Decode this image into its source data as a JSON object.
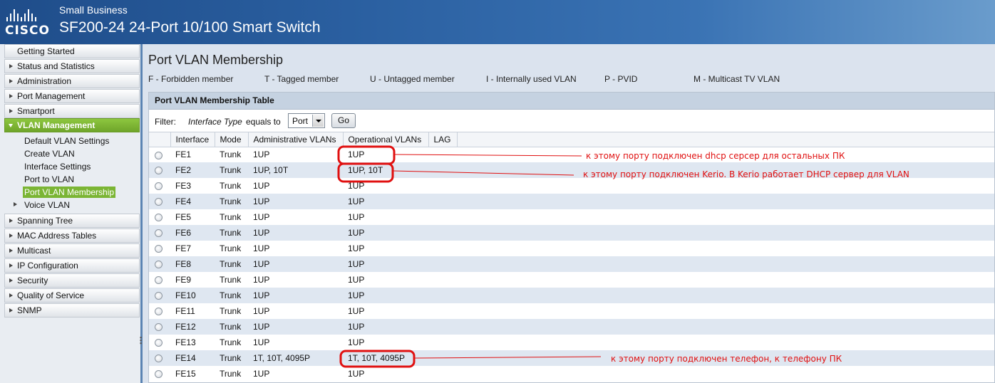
{
  "header": {
    "logo_text": "CISCO",
    "brand": "Small Business",
    "product": "SF200-24 24-Port 10/100 Smart Switch"
  },
  "sidebar": {
    "items": [
      {
        "label": "Getting Started"
      },
      {
        "label": "Status and Statistics"
      },
      {
        "label": "Administration"
      },
      {
        "label": "Port Management"
      },
      {
        "label": "Smartport"
      },
      {
        "label": "VLAN Management"
      },
      {
        "label": "Spanning Tree"
      },
      {
        "label": "MAC Address Tables"
      },
      {
        "label": "Multicast"
      },
      {
        "label": "IP Configuration"
      },
      {
        "label": "Security"
      },
      {
        "label": "Quality of Service"
      },
      {
        "label": "SNMP"
      }
    ],
    "vlan_sub_items": [
      {
        "label": "Default VLAN Settings"
      },
      {
        "label": "Create VLAN"
      },
      {
        "label": "Interface Settings"
      },
      {
        "label": "Port to VLAN"
      },
      {
        "label": "Port VLAN Membership"
      },
      {
        "label": "Voice VLAN"
      }
    ],
    "active_item": "VLAN Management",
    "selected_sub_item": "Port VLAN Membership"
  },
  "main": {
    "title": "Port VLAN Membership",
    "legend": [
      "F - Forbidden member",
      "T - Tagged member",
      "U - Untagged member",
      "I - Internally used VLAN",
      "P - PVID",
      "M - Multicast TV VLAN"
    ],
    "table_title": "Port VLAN Membership Table",
    "filter": {
      "label": "Filter:",
      "field": "Interface Type",
      "operator": "equals to",
      "selected": "Port",
      "go_label": "Go"
    },
    "columns": [
      "Interface",
      "Mode",
      "Administrative VLANs",
      "Operational VLANs",
      "LAG"
    ],
    "rows": [
      {
        "interface": "FE1",
        "mode": "Trunk",
        "admin": "1UP",
        "oper": "1UP",
        "lag": ""
      },
      {
        "interface": "FE2",
        "mode": "Trunk",
        "admin": "1UP, 10T",
        "oper": "1UP, 10T",
        "lag": ""
      },
      {
        "interface": "FE3",
        "mode": "Trunk",
        "admin": "1UP",
        "oper": "1UP",
        "lag": ""
      },
      {
        "interface": "FE4",
        "mode": "Trunk",
        "admin": "1UP",
        "oper": "1UP",
        "lag": ""
      },
      {
        "interface": "FE5",
        "mode": "Trunk",
        "admin": "1UP",
        "oper": "1UP",
        "lag": ""
      },
      {
        "interface": "FE6",
        "mode": "Trunk",
        "admin": "1UP",
        "oper": "1UP",
        "lag": ""
      },
      {
        "interface": "FE7",
        "mode": "Trunk",
        "admin": "1UP",
        "oper": "1UP",
        "lag": ""
      },
      {
        "interface": "FE8",
        "mode": "Trunk",
        "admin": "1UP",
        "oper": "1UP",
        "lag": ""
      },
      {
        "interface": "FE9",
        "mode": "Trunk",
        "admin": "1UP",
        "oper": "1UP",
        "lag": ""
      },
      {
        "interface": "FE10",
        "mode": "Trunk",
        "admin": "1UP",
        "oper": "1UP",
        "lag": ""
      },
      {
        "interface": "FE11",
        "mode": "Trunk",
        "admin": "1UP",
        "oper": "1UP",
        "lag": ""
      },
      {
        "interface": "FE12",
        "mode": "Trunk",
        "admin": "1UP",
        "oper": "1UP",
        "lag": ""
      },
      {
        "interface": "FE13",
        "mode": "Trunk",
        "admin": "1UP",
        "oper": "1UP",
        "lag": ""
      },
      {
        "interface": "FE14",
        "mode": "Trunk",
        "admin": "1T, 10T, 4095P",
        "oper": "1T, 10T, 4095P",
        "lag": ""
      },
      {
        "interface": "FE15",
        "mode": "Trunk",
        "admin": "1UP",
        "oper": "1UP",
        "lag": ""
      }
    ]
  },
  "annotations": [
    {
      "text": "к этому порту подключен dhcp серсер для остальных ПК"
    },
    {
      "text": "к этому порту подключен Kerio. В Kerio работает DHCP сервер для VLAN"
    },
    {
      "text": "к этому порту подключен телефон, к телефону ПК"
    }
  ],
  "colors": {
    "header": "#2a5fa0",
    "nav_active": "#7bb534",
    "row_alt": "#dfe7f1",
    "annotation": "#e01010"
  }
}
